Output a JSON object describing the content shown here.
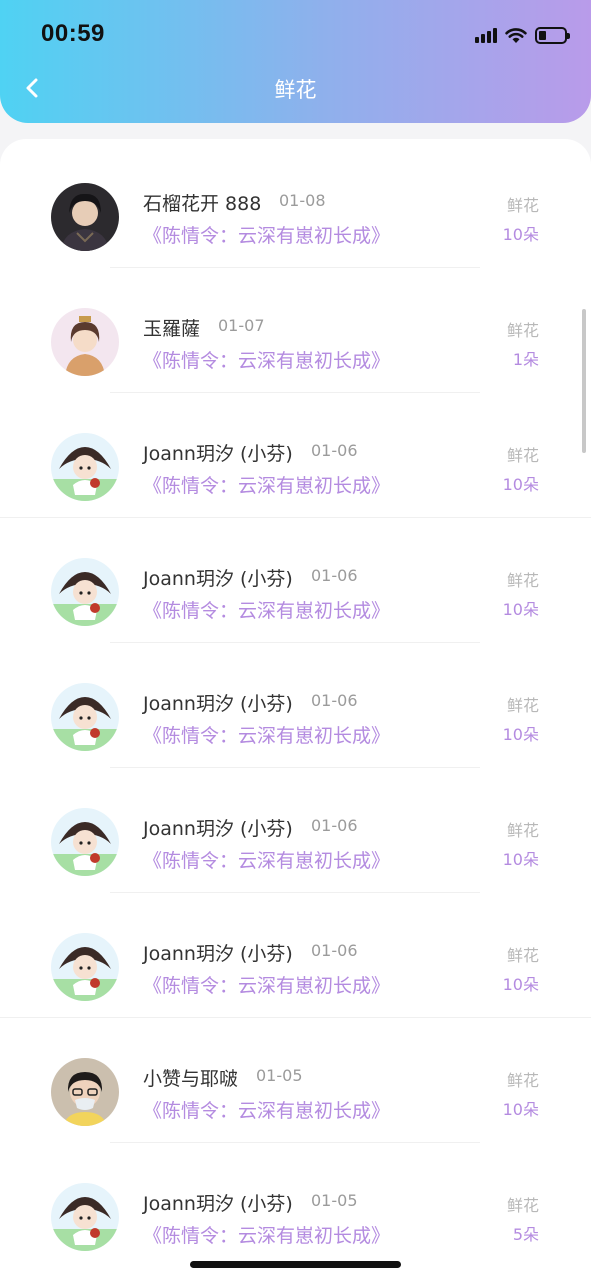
{
  "status_bar": {
    "time": "00:59"
  },
  "header": {
    "title": "鲜花"
  },
  "items": [
    {
      "name": "石榴花开 888",
      "date": "01-08",
      "book": "《陈情令：云深有崽初长成》",
      "kind": "鲜花",
      "count": "10朵",
      "avatar": "avatar-man-icon"
    },
    {
      "name": "玉羅薩",
      "date": "01-07",
      "book": "《陈情令：云深有崽初长成》",
      "kind": "鲜花",
      "count": "1朵",
      "avatar": "avatar-girl-icon"
    },
    {
      "name": "Joann玥汐 (小芬)",
      "date": "01-06",
      "book": "《陈情令：云深有崽初长成》",
      "kind": "鲜花",
      "count": "10朵",
      "avatar": "avatar-chibi-icon"
    },
    {
      "name": "Joann玥汐 (小芬)",
      "date": "01-06",
      "book": "《陈情令：云深有崽初长成》",
      "kind": "鲜花",
      "count": "10朵",
      "avatar": "avatar-chibi-icon"
    },
    {
      "name": "Joann玥汐 (小芬)",
      "date": "01-06",
      "book": "《陈情令：云深有崽初长成》",
      "kind": "鲜花",
      "count": "10朵",
      "avatar": "avatar-chibi-icon"
    },
    {
      "name": "Joann玥汐 (小芬)",
      "date": "01-06",
      "book": "《陈情令：云深有崽初长成》",
      "kind": "鲜花",
      "count": "10朵",
      "avatar": "avatar-chibi-icon"
    },
    {
      "name": "Joann玥汐 (小芬)",
      "date": "01-06",
      "book": "《陈情令：云深有崽初长成》",
      "kind": "鲜花",
      "count": "10朵",
      "avatar": "avatar-chibi-icon"
    },
    {
      "name": "小赞与耶啵",
      "date": "01-05",
      "book": "《陈情令：云深有崽初长成》",
      "kind": "鲜花",
      "count": "10朵",
      "avatar": "avatar-photo-icon"
    },
    {
      "name": "Joann玥汐 (小芬)",
      "date": "01-05",
      "book": "《陈情令：云深有崽初长成》",
      "kind": "鲜花",
      "count": "5朵",
      "avatar": "avatar-chibi-icon"
    }
  ],
  "colors": {
    "accent": "#b48be0",
    "header_start": "#4fd2f3",
    "header_end": "#b99bea"
  }
}
